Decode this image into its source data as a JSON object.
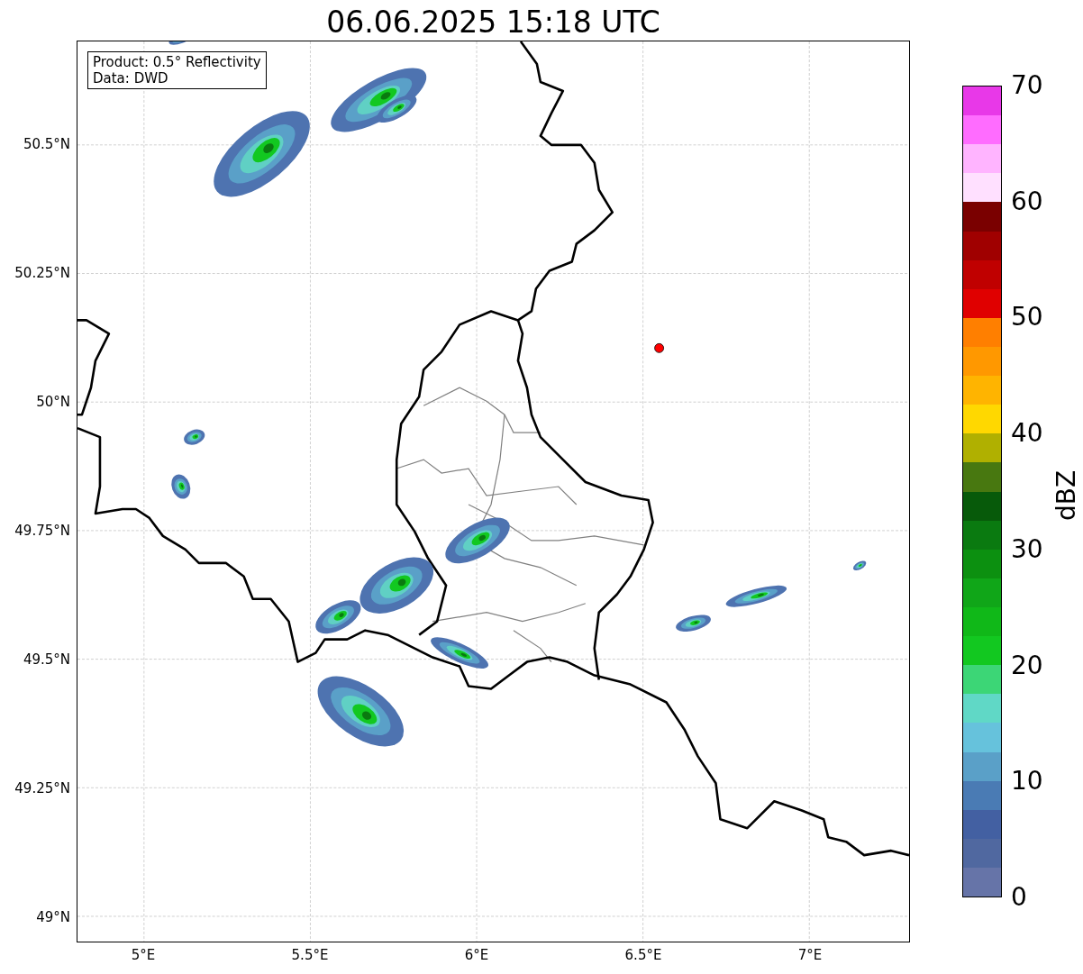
{
  "title": "06.06.2025 15:18 UTC",
  "info_box": {
    "lines": [
      "Product: 0.5° Reflectivity",
      "Data: DWD"
    ]
  },
  "y_ticks": [
    "50.5°N",
    "50.25°N",
    "50°N",
    "49.75°N",
    "49.5°N",
    "49.25°N",
    "49°N"
  ],
  "x_ticks": [
    "5°E",
    "5.5°E",
    "6°E",
    "6.5°E",
    "7°E"
  ],
  "colorbar": {
    "label": "dBZ",
    "ticks": [
      "70",
      "60",
      "50",
      "40",
      "30",
      "20",
      "10",
      "0"
    ],
    "segments": [
      {
        "color": "#e838e8"
      },
      {
        "color": "#ff6cff"
      },
      {
        "color": "#ffb4ff"
      },
      {
        "color": "#ffe0ff"
      },
      {
        "color": "#7a0000"
      },
      {
        "color": "#a00000"
      },
      {
        "color": "#c00000"
      },
      {
        "color": "#e00000"
      },
      {
        "color": "#ff7f00"
      },
      {
        "color": "#ff9800"
      },
      {
        "color": "#ffb400"
      },
      {
        "color": "#ffd800"
      },
      {
        "color": "#b0b000"
      },
      {
        "color": "#487810"
      },
      {
        "color": "#075a0a"
      },
      {
        "color": "#0a7a10"
      },
      {
        "color": "#0c9010"
      },
      {
        "color": "#10a618"
      },
      {
        "color": "#10b818"
      },
      {
        "color": "#12c820"
      },
      {
        "color": "#3cd676"
      },
      {
        "color": "#60d8c6"
      },
      {
        "color": "#66c2dc"
      },
      {
        "color": "#5aa0c8"
      },
      {
        "color": "#4a7bb4"
      },
      {
        "color": "#4360a2"
      },
      {
        "color": "#5068a0"
      },
      {
        "color": "#6674a8"
      }
    ]
  }
}
